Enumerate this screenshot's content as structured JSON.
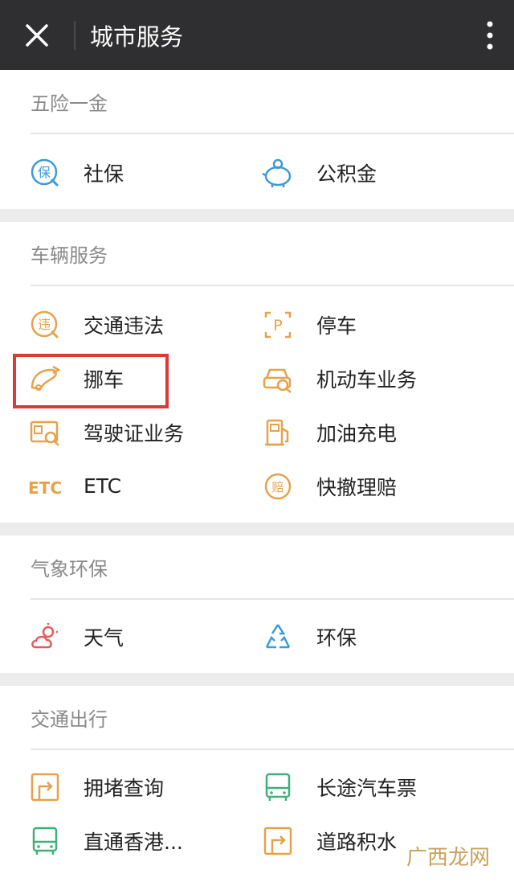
{
  "header": {
    "title": "城市服务"
  },
  "colors": {
    "topbar": "#2f2f31",
    "accent_blue": "#3a9bd8",
    "accent_orange": "#e6a24a",
    "accent_green": "#3fb07a",
    "accent_red": "#e35b5b",
    "highlight": "#d93a3a"
  },
  "sections": [
    {
      "title": "五险一金",
      "items": [
        {
          "label": "社保",
          "icon": "insurance-icon"
        },
        {
          "label": "公积金",
          "icon": "piggy-bank-icon"
        }
      ]
    },
    {
      "title": "车辆服务",
      "items": [
        {
          "label": "交通违法",
          "icon": "violation-icon"
        },
        {
          "label": "停车",
          "icon": "parking-icon"
        },
        {
          "label": "挪车",
          "icon": "move-car-icon"
        },
        {
          "label": "机动车业务",
          "icon": "vehicle-business-icon"
        },
        {
          "label": "驾驶证业务",
          "icon": "license-icon"
        },
        {
          "label": "加油充电",
          "icon": "fuel-icon"
        },
        {
          "label": "ETC",
          "icon": "etc-icon"
        },
        {
          "label": "快撤理赔",
          "icon": "claim-icon"
        }
      ]
    },
    {
      "title": "气象环保",
      "items": [
        {
          "label": "天气",
          "icon": "weather-icon"
        },
        {
          "label": "环保",
          "icon": "recycle-icon"
        }
      ]
    },
    {
      "title": "交通出行",
      "items": [
        {
          "label": "拥堵查询",
          "icon": "congestion-icon"
        },
        {
          "label": "长途汽车票",
          "icon": "bus-icon"
        },
        {
          "label": "直通香港...",
          "icon": "hk-bus-icon"
        },
        {
          "label": "道路积水",
          "icon": "road-water-icon"
        }
      ]
    }
  ],
  "watermark": {
    "text": "广西龙网"
  }
}
